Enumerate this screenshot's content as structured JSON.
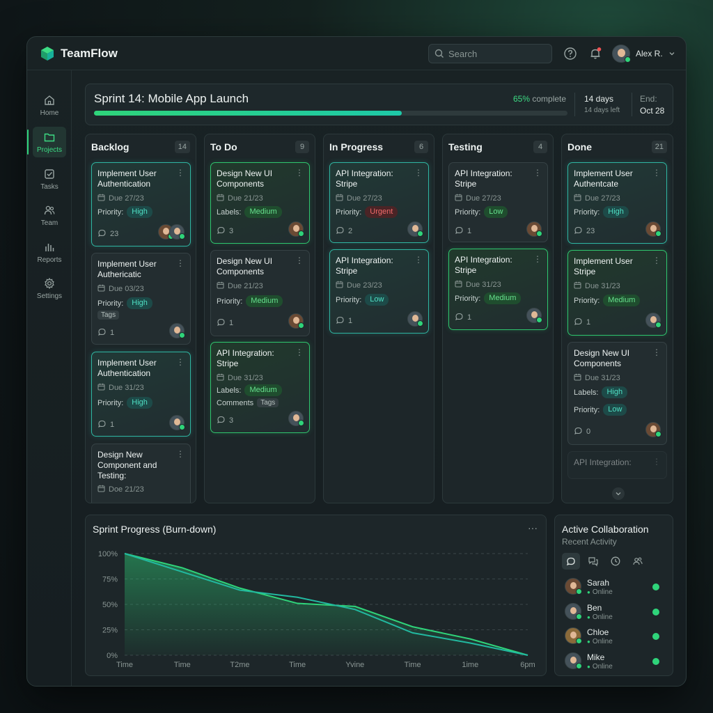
{
  "app": {
    "name": "TeamFlow"
  },
  "header": {
    "search_placeholder": "Search",
    "user_name": "Alex R."
  },
  "sidebar": {
    "items": [
      {
        "label": "Home",
        "icon": "home-icon"
      },
      {
        "label": "Projects",
        "icon": "folder-icon",
        "active": true
      },
      {
        "label": "Tasks",
        "icon": "checkbox-icon"
      },
      {
        "label": "Team",
        "icon": "users-icon"
      },
      {
        "label": "Reports",
        "icon": "bar-chart-icon"
      },
      {
        "label": "Settings",
        "icon": "gear-icon"
      }
    ]
  },
  "sprint": {
    "title": "Sprint 14: Mobile App Launch",
    "percent": "65%",
    "percent_suffix": " complete",
    "progress": 0.65,
    "days": "14 days",
    "days_left": "14 days left",
    "end_label": "End:",
    "end_date": "Oct 28"
  },
  "columns": [
    {
      "name": "Backlog",
      "count": "14",
      "cards": [
        {
          "title": "Implement User Authentication",
          "due": "Due 27/23",
          "row1_label": "Priority:",
          "row1_pill": "High",
          "row1_pill_type": "high",
          "comments": "23",
          "style": "teal"
        },
        {
          "title": "Implement User Authericatic",
          "due": "Due 03/23",
          "row1_label": "Priority:",
          "row1_pill": "High",
          "row1_pill_type": "high",
          "tag": "Tags",
          "comments": "1",
          "style": "plain"
        },
        {
          "title": "Implement User Authentication",
          "due": "Due 31/23",
          "row1_label": "Priority:",
          "row1_pill": "High",
          "row1_pill_type": "high",
          "comments": "1",
          "style": "teal"
        },
        {
          "title": "Design New Component and Testing:",
          "due": "Doe 21/23",
          "style": "plain"
        }
      ]
    },
    {
      "name": "To Do",
      "count": "9",
      "cards": [
        {
          "title": "Design New UI Components",
          "due": "Due 21/23",
          "row1_label": "Labels:",
          "row1_pill": "Medium",
          "row1_pill_type": "medium",
          "comments": "3",
          "style": "green"
        },
        {
          "title": "Design New UI Components",
          "due": "Due 21/23",
          "row1_label": "Priority:",
          "row1_pill": "Medium",
          "row1_pill_type": "medium",
          "comments": "1",
          "style": "plain"
        },
        {
          "title": "API Integration: Stripe",
          "due": "Due 31/23",
          "row1_label": "Labels:",
          "row1_pill": "Medium",
          "row1_pill_type": "medium",
          "row2_label": "Comments",
          "tag": "Tags",
          "comments": "3",
          "style": "green"
        }
      ]
    },
    {
      "name": "In Progress",
      "count": "6",
      "cards": [
        {
          "title": "API Integration: Stripe",
          "due": "Due 27/23",
          "row1_label": "Priority:",
          "row1_pill": "Urgent",
          "row1_pill_type": "urgent",
          "comments": "2",
          "style": "teal"
        },
        {
          "title": "API Integration: Stripe",
          "due": "Due 23/23",
          "row1_label": "Priority:",
          "row1_pill": "Low",
          "row1_pill_type": "high",
          "comments": "1",
          "style": "teal"
        }
      ]
    },
    {
      "name": "Testing",
      "count": "4",
      "cards": [
        {
          "title": "API Integration: Stripe",
          "due": "Due 27/23",
          "row1_label": "Priority:",
          "row1_pill": "Low",
          "row1_pill_type": "low",
          "comments": "1",
          "style": "plain"
        },
        {
          "title": "API Integration: Stripe",
          "due": "Due 31/23",
          "row1_label": "Priority:",
          "row1_pill": "Medium",
          "row1_pill_type": "medium",
          "comments": "1",
          "style": "green"
        }
      ]
    },
    {
      "name": "Done",
      "count": "21",
      "cards": [
        {
          "title": "Implement User Authentcate",
          "due": "Due 27/23",
          "row1_label": "Priority:",
          "row1_pill": "High",
          "row1_pill_type": "high",
          "comments": "23",
          "style": "teal"
        },
        {
          "title": "Implement User Stripe",
          "due": "Due 31/23",
          "row1_label": "Priority:",
          "row1_pill": "Medium",
          "row1_pill_type": "medium",
          "comments": "1",
          "style": "green"
        },
        {
          "title": "Design New UI Components",
          "due": "Due 31/23",
          "row1_label": "Labels:",
          "row1_pill": "High",
          "row1_pill_type": "high",
          "row2_label": "Priority:",
          "row2_pill": "Low",
          "row2_pill_type": "high",
          "comments": "0",
          "style": "plain"
        },
        {
          "title": "API Integration:",
          "style": "faded"
        }
      ]
    }
  ],
  "burndown": {
    "title": "Sprint Progress (Burn-down)",
    "more": "···"
  },
  "chart_data": {
    "type": "line",
    "title": "Sprint Progress (Burn-down)",
    "categories": [
      "Time",
      "Time",
      "T2me",
      "Time",
      "Yvine",
      "Time",
      "1ime",
      "6pm"
    ],
    "y_ticks": [
      "100%",
      "75%",
      "50%",
      "25%",
      "0%"
    ],
    "ylim": [
      0,
      100
    ],
    "grid": true,
    "series": [
      {
        "values": [
          100,
          86,
          66,
          51,
          48,
          28,
          16,
          0
        ],
        "color": "#2fd47a",
        "filled": true
      },
      {
        "values": [
          100,
          82,
          64,
          57,
          45,
          22,
          12,
          0
        ],
        "color": "#22b9a0",
        "filled": false
      }
    ]
  },
  "collab": {
    "title": "Active Collaboration",
    "subtitle": "Recent Activity",
    "tabs": [
      "chat-icon",
      "comments-icon",
      "clock-icon",
      "users-icon"
    ],
    "people": [
      {
        "name": "Sarah",
        "status": "Online"
      },
      {
        "name": "Ben",
        "status": "Online"
      },
      {
        "name": "Chloe",
        "status": "Online"
      },
      {
        "name": "Mike",
        "status": "Online"
      }
    ]
  }
}
